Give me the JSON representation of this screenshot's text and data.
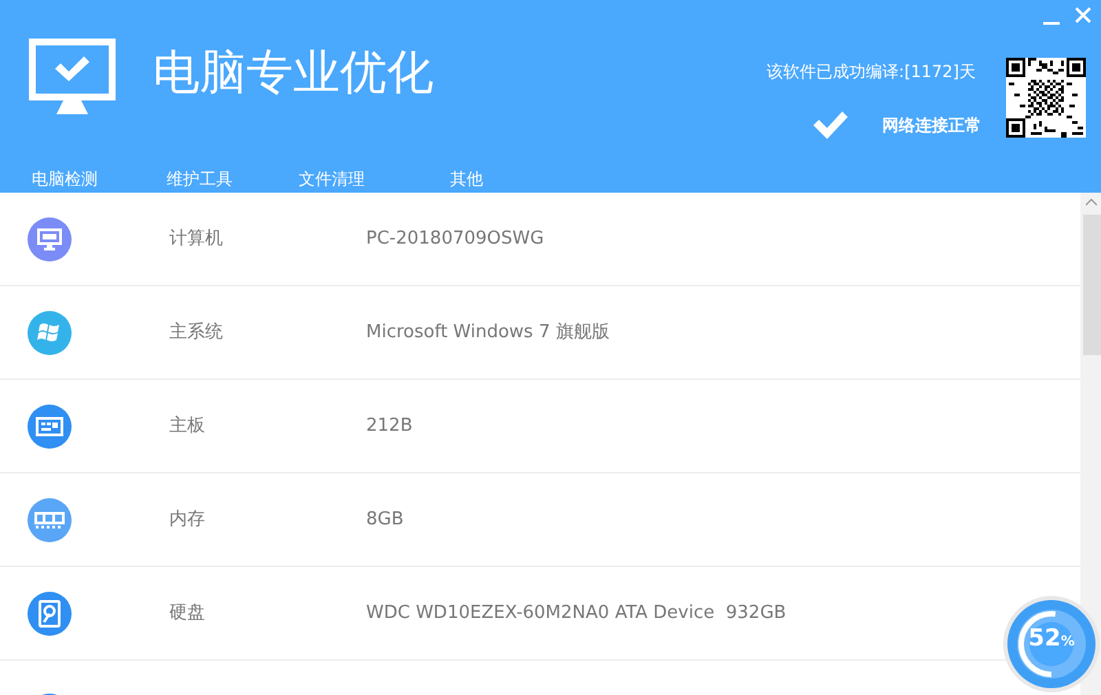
{
  "window": {
    "title": "电脑专业优化",
    "compile_info": "该软件已成功编译:[1172]天",
    "network_status": "网络连接正常"
  },
  "tabs": [
    {
      "label": "电脑检测"
    },
    {
      "label": "维护工具"
    },
    {
      "label": "文件清理"
    },
    {
      "label": "其他"
    }
  ],
  "items": [
    {
      "kind": "monitor",
      "color": "#7b8cf7",
      "label": "计算机",
      "value": "PC-20180709OSWG"
    },
    {
      "kind": "windows",
      "color": "#33b3ea",
      "label": "主系统",
      "value": "Microsoft Windows 7 旗舰版"
    },
    {
      "kind": "board",
      "color": "#2f8ff2",
      "label": "主板",
      "value": "212B"
    },
    {
      "kind": "memory",
      "color": "#5aa6f6",
      "label": "内存",
      "value": "8GB"
    },
    {
      "kind": "disk",
      "color": "#2f8ff2",
      "label": "硬盘",
      "value": "WDC WD10EZEX-60M2NA0 ATA Device  932GB"
    },
    {
      "kind": "partial",
      "color": "#2f8ff2"
    }
  ],
  "gauge": {
    "level": 0.52,
    "value": "52",
    "unit": "%"
  }
}
